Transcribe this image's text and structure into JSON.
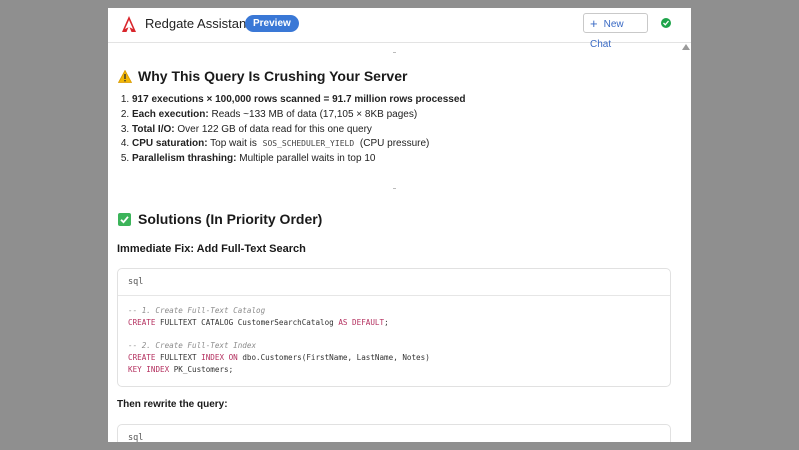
{
  "header": {
    "app_title": "Redgate Assistant",
    "badge": "Preview",
    "new_chat_label": "New Chat",
    "colors": {
      "badge": "#3a78d6",
      "status": "#1ea44a",
      "logo": "#d9262c"
    }
  },
  "section_why": {
    "title": "Why This Query Is Crushing Your Server",
    "items": [
      {
        "bold": "917 executions × 100,000 rows scanned = 91.7 million rows processed",
        "text": ""
      },
      {
        "bold": "Each execution:",
        "text": " Reads ~133 MB of data (17,105 × 8KB pages)"
      },
      {
        "bold": "Total I/O:",
        "text": " Over 122 GB of data read for this one query"
      },
      {
        "bold": "CPU saturation:",
        "text": " Top wait is ",
        "code": "SOS_SCHEDULER_YIELD",
        "after": " (CPU pressure)"
      },
      {
        "bold": "Parallelism thrashing:",
        "text": " Multiple parallel waits in top 10"
      }
    ]
  },
  "section_solutions": {
    "title": "Solutions (In Priority Order)",
    "fix_heading": "Immediate Fix: Add Full-Text Search",
    "code_lang": "sql",
    "code": {
      "c1": "-- 1. Create Full-Text Catalog",
      "l2a": "CREATE",
      "l2b": " FULLTEXT CATALOG CustomerSearchCatalog ",
      "l2c": "AS",
      "l2d": " ",
      "l2e": "DEFAULT",
      "l2f": ";",
      "c2": "-- 2. Create Full-Text Index",
      "l5a": "CREATE",
      "l5b": " FULLTEXT ",
      "l5c": "INDEX",
      "l5d": " ",
      "l5e": "ON",
      "l5f": " dbo.Customers(FirstName, LastName, Notes)",
      "l6a": "KEY",
      "l6b": " ",
      "l6c": "INDEX",
      "l6d": " PK_Customers;"
    },
    "rewrite_heading": "Then rewrite the query:",
    "code2_lang": "sql"
  }
}
